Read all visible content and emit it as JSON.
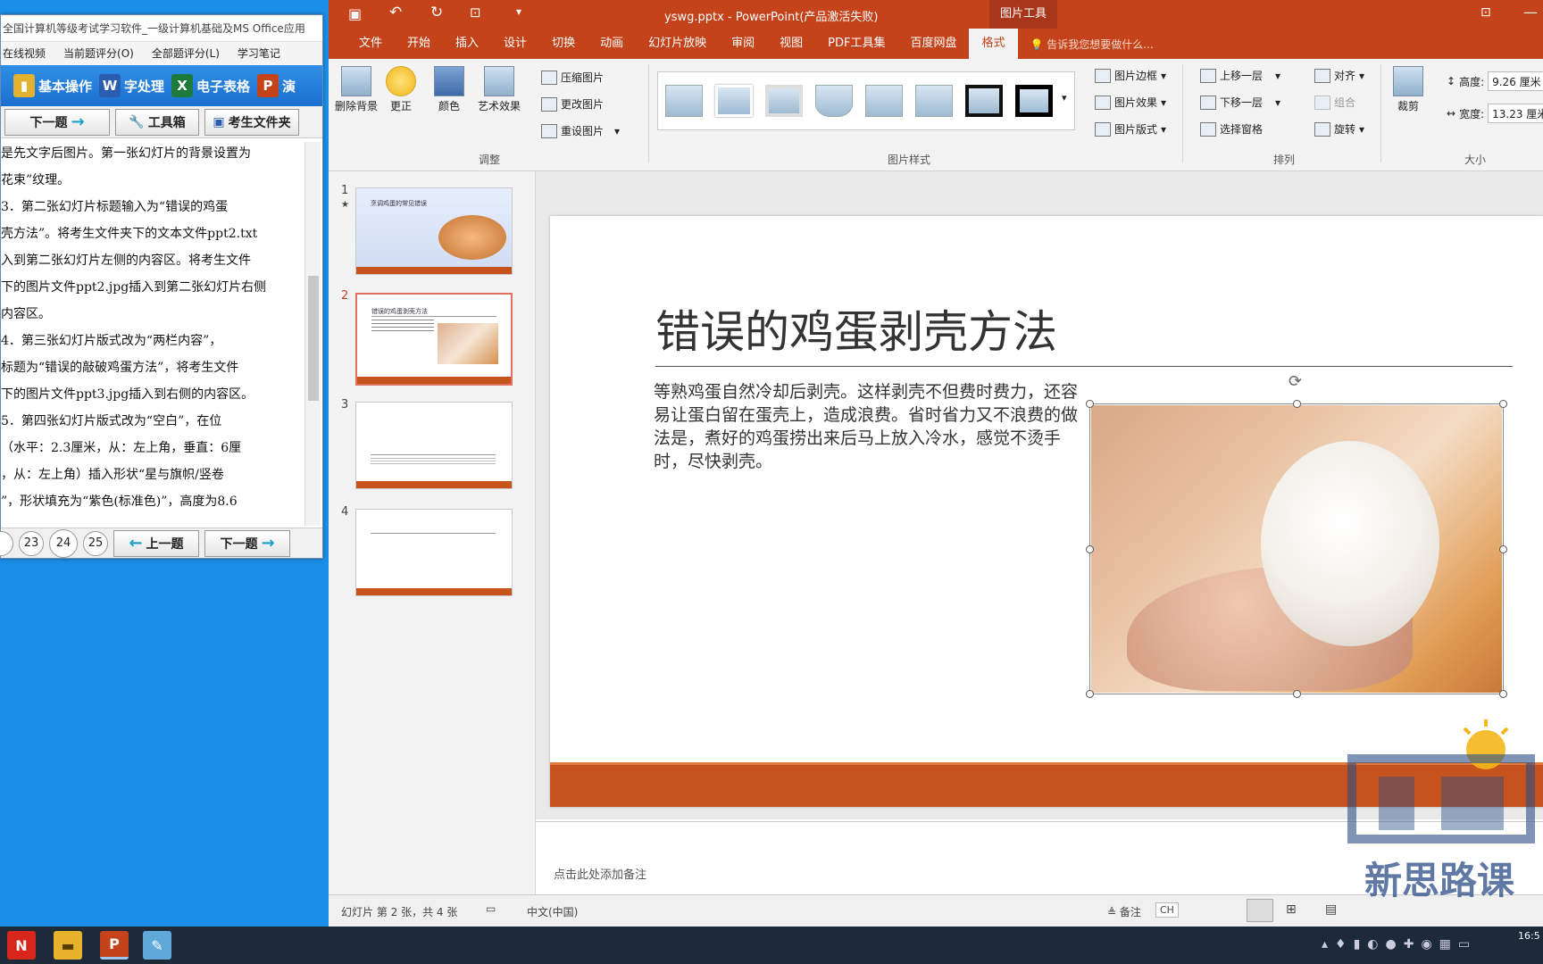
{
  "exam": {
    "title": "全国计算机等级考试学习软件_一级计算机基础及MS Office应用",
    "menu": [
      "在线视频",
      "当前题评分(O)",
      "全部题评分(L)",
      "学习笔记"
    ],
    "apps": [
      {
        "label": "基本操作",
        "icon": "folder-icon",
        "color": "#d9a21b"
      },
      {
        "label": "字处理",
        "icon": "word-icon",
        "color": "#2a5db0",
        "glyph": "W"
      },
      {
        "label": "电子表格",
        "icon": "excel-icon",
        "color": "#1e7a3a",
        "glyph": "X"
      },
      {
        "label": "演",
        "icon": "powerpoint-icon",
        "color": "#c5431b",
        "glyph": "P"
      }
    ],
    "nav": {
      "next": "下一题",
      "toolbox": "工具箱",
      "folder": "考生文件夹"
    },
    "text_lines": [
      "是先文字后图片。第一张幻灯片的背景设置为",
      "花束”纹理。",
      "   3．第二张幻灯片标题输入为“错误的鸡蛋",
      "壳方法”。将考生文件夹下的文本文件ppt2.txt",
      "入到第二张幻灯片左侧的内容区。将考生文件",
      "下的图片文件ppt2.jpg插入到第二张幻灯片右侧",
      "内容区。",
      "   4．第三张幻灯片版式改为“两栏内容”，",
      "标题为“错误的敲破鸡蛋方法”，将考生文件",
      "下的图片文件ppt3.jpg插入到右侧的内容区。",
      "   5．第四张幻灯片版式改为“空白”，在位",
      "（水平：2.3厘米，从：左上角，垂直：6厘",
      "，从：左上角）插入形状“星与旗帜/竖卷",
      "”，形状填充为“紫色(标准色)”，高度为8.6"
    ],
    "question_numbers": [
      "23",
      "24",
      "25"
    ],
    "prev": "上一题",
    "next2": "下一题"
  },
  "ppt": {
    "filename": "yswg.pptx - PowerPoint(产品激活失败)",
    "context_tab": "图片工具",
    "tabs": [
      "文件",
      "开始",
      "插入",
      "设计",
      "切换",
      "动画",
      "幻灯片放映",
      "审阅",
      "视图",
      "PDF工具集",
      "百度网盘",
      "格式"
    ],
    "active_tab": "格式",
    "tell_me": "告诉我您想要做什么...",
    "ribbon": {
      "adjust": {
        "remove_bg": "删除背景",
        "correct": "更正",
        "color": "颜色",
        "artistic": "艺术效果",
        "compress": "压缩图片",
        "change": "更改图片",
        "reset": "重设图片",
        "label": "调整"
      },
      "styles": {
        "border": "图片边框",
        "effects": "图片效果",
        "layout": "图片版式",
        "label": "图片样式"
      },
      "arrange": {
        "forward": "上移一层",
        "backward": "下移一层",
        "pane": "选择窗格",
        "align": "对齐",
        "group": "组合",
        "rotate": "旋转",
        "label": "排列"
      },
      "size": {
        "crop": "裁剪",
        "height_label": "高度:",
        "height": "9.26 厘米",
        "width_label": "宽度:",
        "width": "13.23 厘米",
        "label": "大小"
      }
    },
    "thumbs": [
      {
        "num": "1",
        "star": "★",
        "title": "烹调鸡蛋的常见错误"
      },
      {
        "num": "2",
        "title": "错误的鸡蛋剥壳方法"
      },
      {
        "num": "3"
      },
      {
        "num": "4"
      }
    ],
    "slide": {
      "title": "错误的鸡蛋剥壳方法",
      "body": "等熟鸡蛋自然冷却后剥壳。这样剥壳不但费时费力，还容易让蛋白留在蛋壳上，造成浪费。省时省力又不浪费的做法是，煮好的鸡蛋捞出来后马上放入冷水，感觉不烫手时，尽快剥壳。"
    },
    "notes_placeholder": "点击此处添加备注",
    "status": {
      "slide_info": "幻灯片 第 2 张，共 4 张",
      "language": "中文(中国)",
      "notes": "备注",
      "ime": "CH"
    }
  },
  "watermark": {
    "text": "新思路课"
  },
  "taskbar": {
    "time": "16:5"
  }
}
